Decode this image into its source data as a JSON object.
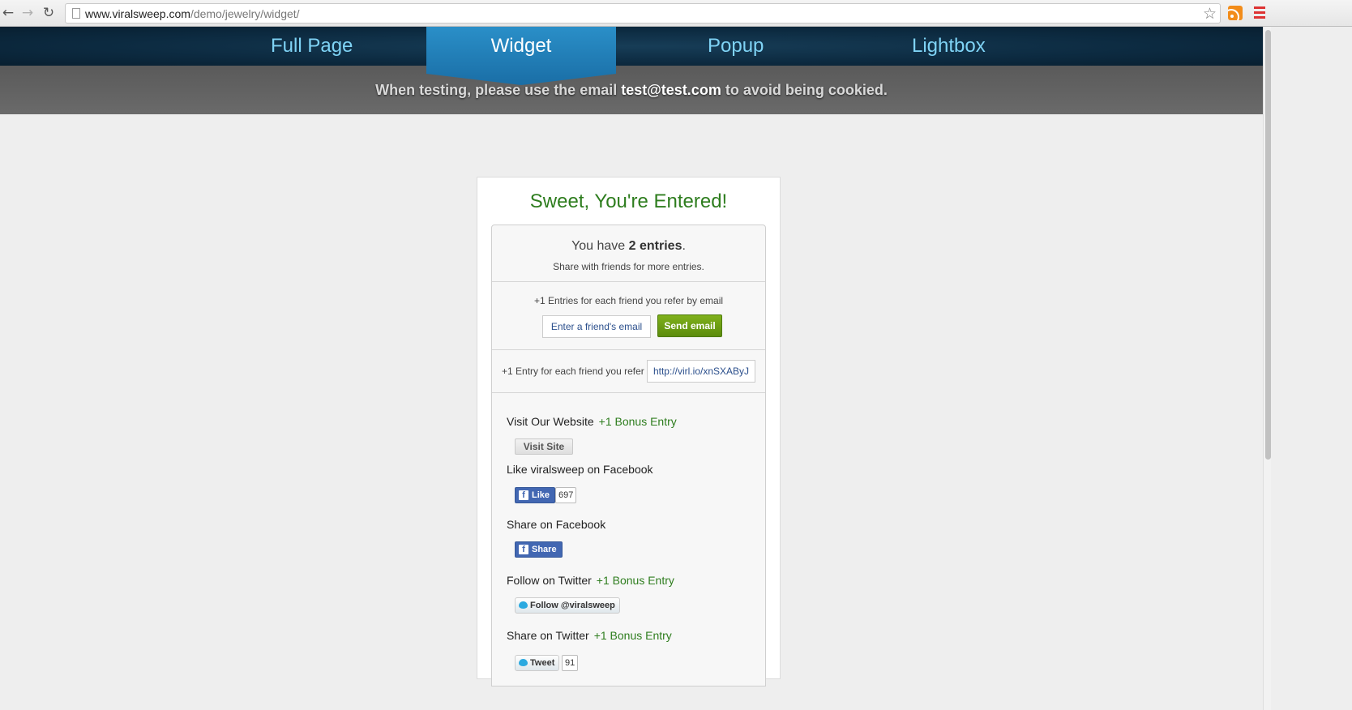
{
  "browser": {
    "url_host": "www.viralsweep.com",
    "url_path": "/demo/jewelry/widget/",
    "back_glyph": "←",
    "forward_glyph": "→",
    "reload_glyph": "↻",
    "star_glyph": "☆"
  },
  "nav": {
    "items": [
      "Full Page",
      "Widget",
      "Popup",
      "Lightbox"
    ],
    "active": "Widget"
  },
  "banner": {
    "prefix": "When testing, please use the email ",
    "email": "test@test.com",
    "suffix": " to avoid being cookied."
  },
  "widget": {
    "title": "Sweet, You're Entered!",
    "entries_prefix": "You have ",
    "entries_count": "2 entries",
    "entries_suffix": ".",
    "share_text": "Share with friends for more entries.",
    "refer_email_label": "+1 Entries for each friend you refer by email",
    "friend_email_placeholder": "Enter a friend's email",
    "send_email_label": "Send email",
    "refer_label": "+1 Entry for each friend you refer",
    "refer_link": "http://virl.io/xnSXAByJ",
    "actions": [
      {
        "label": "Visit Our Website",
        "bonus": "+1 Bonus Entry",
        "button": "Visit Site"
      },
      {
        "label": "Like viralsweep on Facebook",
        "bonus": "",
        "button": "Like",
        "count": "697"
      },
      {
        "label": "Share on Facebook",
        "bonus": "",
        "button": "Share"
      },
      {
        "label": "Follow on Twitter",
        "bonus": "+1 Bonus Entry",
        "button": "Follow @viralsweep"
      },
      {
        "label": "Share on Twitter",
        "bonus": "+1 Bonus Entry",
        "button": "Tweet",
        "count": "91"
      }
    ]
  },
  "colors": {
    "title_green": "#2e7d1e",
    "send_green": "#6a9c12",
    "facebook_blue": "#4267b2",
    "nav_link": "#7fd3f5",
    "nav_dark": "#0c2a40"
  }
}
